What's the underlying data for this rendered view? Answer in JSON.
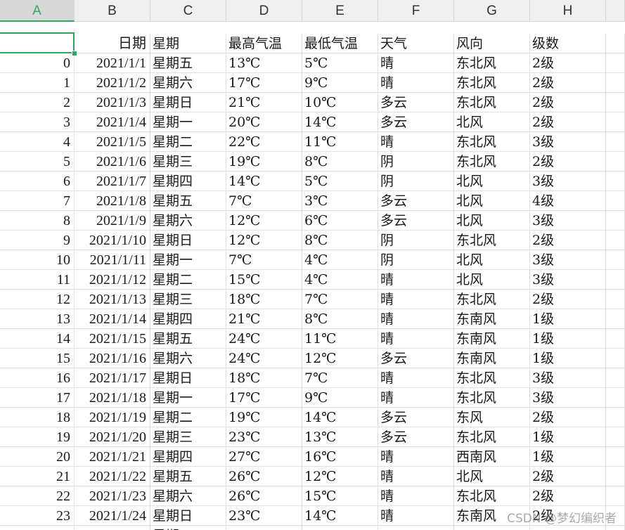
{
  "column_headers": [
    "A",
    "B",
    "C",
    "D",
    "E",
    "F",
    "G",
    "H"
  ],
  "active_column": "A",
  "field_headers": [
    "",
    "日期",
    "星期",
    "最高气温",
    "最低气温",
    "天气",
    "风向",
    "级数"
  ],
  "rows": [
    [
      "0",
      "2021/1/1",
      "星期五",
      "13℃",
      "5℃",
      "晴",
      "东北风",
      "2级"
    ],
    [
      "1",
      "2021/1/2",
      "星期六",
      "17℃",
      "9℃",
      "晴",
      "东北风",
      "2级"
    ],
    [
      "2",
      "2021/1/3",
      "星期日",
      "21℃",
      "10℃",
      "多云",
      "东北风",
      "2级"
    ],
    [
      "3",
      "2021/1/4",
      "星期一",
      "20℃",
      "14℃",
      "多云",
      "北风",
      "2级"
    ],
    [
      "4",
      "2021/1/5",
      "星期二",
      "22℃",
      "11℃",
      "晴",
      "东北风",
      "3级"
    ],
    [
      "5",
      "2021/1/6",
      "星期三",
      "19℃",
      "8℃",
      "阴",
      "东北风",
      "2级"
    ],
    [
      "6",
      "2021/1/7",
      "星期四",
      "14℃",
      "5℃",
      "阴",
      "北风",
      "3级"
    ],
    [
      "7",
      "2021/1/8",
      "星期五",
      "7℃",
      "3℃",
      "多云",
      "北风",
      "4级"
    ],
    [
      "8",
      "2021/1/9",
      "星期六",
      "12℃",
      "6℃",
      "多云",
      "北风",
      "3级"
    ],
    [
      "9",
      "2021/1/10",
      "星期日",
      "12℃",
      "8℃",
      "阴",
      "东北风",
      "2级"
    ],
    [
      "10",
      "2021/1/11",
      "星期一",
      "7℃",
      "4℃",
      "阴",
      "北风",
      "3级"
    ],
    [
      "11",
      "2021/1/12",
      "星期二",
      "15℃",
      "4℃",
      "晴",
      "北风",
      "3级"
    ],
    [
      "12",
      "2021/1/13",
      "星期三",
      "18℃",
      "7℃",
      "晴",
      "东北风",
      "2级"
    ],
    [
      "13",
      "2021/1/14",
      "星期四",
      "21℃",
      "8℃",
      "晴",
      "东南风",
      "1级"
    ],
    [
      "14",
      "2021/1/15",
      "星期五",
      "24℃",
      "11℃",
      "晴",
      "东南风",
      "1级"
    ],
    [
      "15",
      "2021/1/16",
      "星期六",
      "24℃",
      "12℃",
      "多云",
      "东南风",
      "1级"
    ],
    [
      "16",
      "2021/1/17",
      "星期日",
      "18℃",
      "7℃",
      "晴",
      "东北风",
      "3级"
    ],
    [
      "17",
      "2021/1/18",
      "星期一",
      "17℃",
      "9℃",
      "晴",
      "东北风",
      "3级"
    ],
    [
      "18",
      "2021/1/19",
      "星期二",
      "19℃",
      "14℃",
      "多云",
      "东风",
      "2级"
    ],
    [
      "19",
      "2021/1/20",
      "星期三",
      "23℃",
      "13℃",
      "多云",
      "东北风",
      "1级"
    ],
    [
      "20",
      "2021/1/21",
      "星期四",
      "27℃",
      "16℃",
      "晴",
      "西南风",
      "1级"
    ],
    [
      "21",
      "2021/1/22",
      "星期五",
      "26℃",
      "12℃",
      "晴",
      "北风",
      "2级"
    ],
    [
      "22",
      "2021/1/23",
      "星期六",
      "26℃",
      "15℃",
      "晴",
      "东北风",
      "2级"
    ],
    [
      "23",
      "2021/1/24",
      "星期日",
      "23℃",
      "14℃",
      "晴",
      "东南风",
      "2级"
    ]
  ],
  "partial_row": [
    "",
    "",
    "星期",
    "",
    "",
    "",
    "",
    ""
  ],
  "watermark": "CSDN @梦幻编织者",
  "accent_color": "#2eaa5f"
}
